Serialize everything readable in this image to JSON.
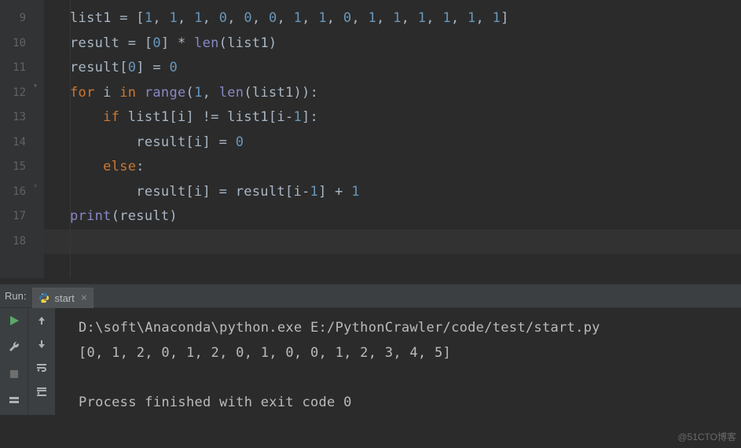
{
  "gutter": {
    "lines": [
      "9",
      "10",
      "11",
      "12",
      "13",
      "14",
      "15",
      "16",
      "17",
      "18"
    ]
  },
  "code": {
    "l9": {
      "a": "list1 = [",
      "n1": "1",
      "c": ", ",
      "n2": "1",
      "n3": "1",
      "n4": "0",
      "n5": "0",
      "n6": "0",
      "n7": "1",
      "n8": "1",
      "n9": "0",
      "n10": "1",
      "n11": "1",
      "n12": "1",
      "n13": "1",
      "n14": "1",
      "n15": "1",
      "z": "]"
    },
    "l10": {
      "a": "result = [",
      "n1": "0",
      "b": "] * ",
      "fn": "len",
      "c": "(list1)"
    },
    "l11": {
      "a": "result[",
      "n1": "0",
      "b": "] = ",
      "n2": "0"
    },
    "l12": {
      "kw1": "for",
      "a": " i ",
      "kw2": "in",
      "b": " ",
      "fn": "range",
      "c": "(",
      "n1": "1",
      "d": ", ",
      "fn2": "len",
      "e": "(list1)):"
    },
    "l13": {
      "kw1": "if",
      "a": " list1[i] != list1[i-",
      "n1": "1",
      "b": "]:"
    },
    "l14": {
      "a": "result[i] = ",
      "n1": "0"
    },
    "l15": {
      "kw1": "else",
      "a": ":"
    },
    "l16": {
      "a": "result[i] = result[i-",
      "n1": "1",
      "b": "] + ",
      "n2": "1"
    },
    "l17": {
      "fn": "print",
      "a": "(result)"
    }
  },
  "run": {
    "label": "Run:",
    "tab": "start",
    "out1": "D:\\soft\\Anaconda\\python.exe E:/PythonCrawler/code/test/start.py",
    "out2": "[0, 1, 2, 0, 1, 2, 0, 1, 0, 0, 1, 2, 3, 4, 5]",
    "out3": "",
    "out4": "Process finished with exit code 0"
  },
  "watermark": "@51CTO博客"
}
